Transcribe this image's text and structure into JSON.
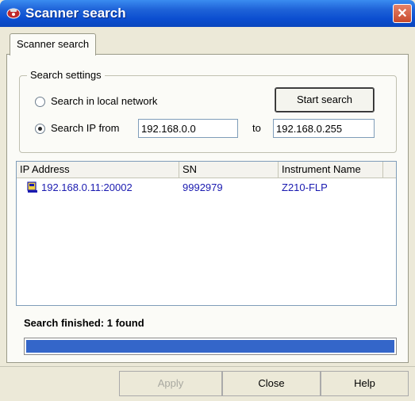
{
  "window": {
    "title": "Scanner search",
    "close_glyph": "✕"
  },
  "tabs": [
    {
      "label": "Scanner search",
      "active": true
    }
  ],
  "search_settings": {
    "group_title": "Search settings",
    "local_label": "Search in local network",
    "ip_label": "Search IP from",
    "selected": "ip_range",
    "ip_from": "192.168.0.0",
    "to_label": "to",
    "ip_to": "192.168.0.255",
    "start_button": "Start search"
  },
  "results": {
    "columns": [
      "IP Address",
      "SN",
      "Instrument Name"
    ],
    "rows": [
      {
        "ip": "192.168.0.11:20002",
        "sn": "9992979",
        "name": "Z210-FLP",
        "icon": "scanner-device-icon"
      }
    ]
  },
  "status": {
    "text": "Search finished: 1 found",
    "progress_fraction": 1.0
  },
  "buttons": {
    "apply": "Apply",
    "apply_enabled": false,
    "close": "Close",
    "help": "Help"
  },
  "colors": {
    "titlebar": "#0b4ed0",
    "list_text": "#1a1ab0",
    "progress": "#3466c9",
    "close_button": "#c84a2c"
  }
}
